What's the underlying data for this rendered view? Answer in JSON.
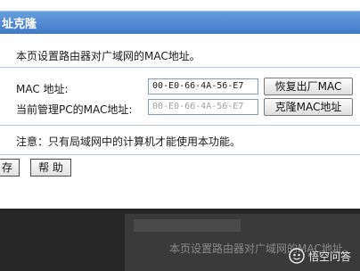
{
  "header": {
    "title": "址克隆"
  },
  "main": {
    "description": "本页设置路由器对广域网的MAC地址。",
    "mac_label": "MAC 地址:",
    "mac_value": "00-E0-66-4A-56-E7",
    "restore_button": "恢复出厂MAC",
    "pc_mac_label": "当前管理PC的MAC地址:",
    "pc_mac_value": "00-E0-66-4A-56-E7",
    "clone_button": "克隆MAC地址",
    "note": "注意：只有局域网中的计算机才能使用本功能。"
  },
  "footer": {
    "save_button": "存",
    "help_button": "帮 助"
  },
  "overlay": {
    "ghost_text": "本页设置路由器对广域网的MAC地址。",
    "watermark_text": "悟空问答",
    "watermark_icon": "wukong-logo-icon"
  }
}
